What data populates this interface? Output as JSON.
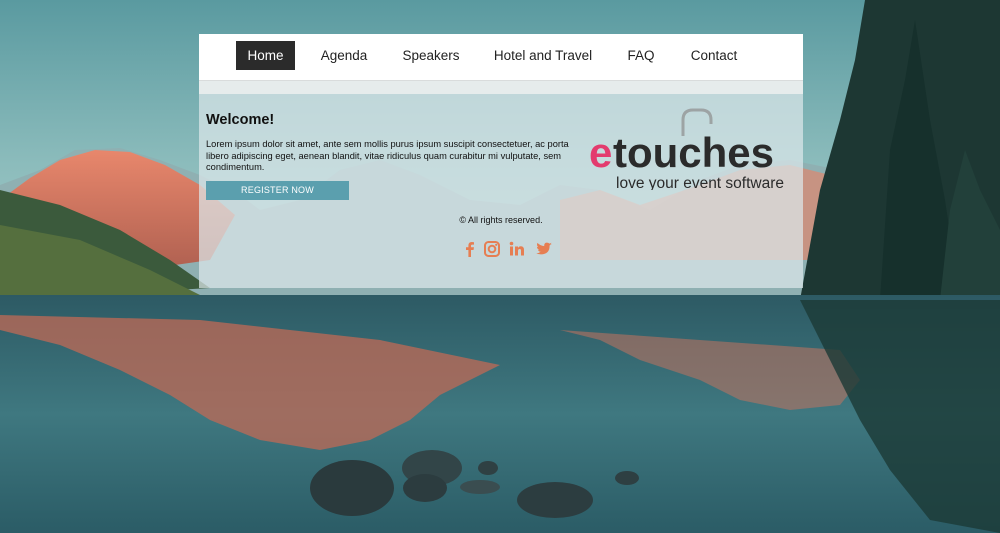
{
  "colors": {
    "nav_bg": "#ffffff",
    "nav_active_bg": "#2b2b2b",
    "button_bg": "#5b9fae",
    "logo_pink": "#e33b6e",
    "logo_dark": "#2b2b2b",
    "social": "#e67e52"
  },
  "nav": {
    "items": [
      {
        "label": "Home",
        "active": true
      },
      {
        "label": "Agenda",
        "active": false
      },
      {
        "label": "Speakers",
        "active": false
      },
      {
        "label": "Hotel and Travel",
        "active": false
      },
      {
        "label": "FAQ",
        "active": false
      },
      {
        "label": "Contact",
        "active": false
      }
    ]
  },
  "welcome": {
    "title": "Welcome!",
    "text": "Lorem ipsum dolor sit amet, ante sem mollis purus ipsum suscipit consectetuer, ac porta libero adipiscing eget, aenean blandit, vitae ridiculus quam curabitur mi vulputate, sem condimentum.",
    "button_label": "REGISTER NOW"
  },
  "logo": {
    "e": "e",
    "rest": "touches",
    "tagline": "love your event software"
  },
  "footer": {
    "copyright": "© All rights reserved.",
    "social_icons": [
      "facebook-icon",
      "instagram-icon",
      "linkedin-icon",
      "twitter-icon"
    ]
  }
}
